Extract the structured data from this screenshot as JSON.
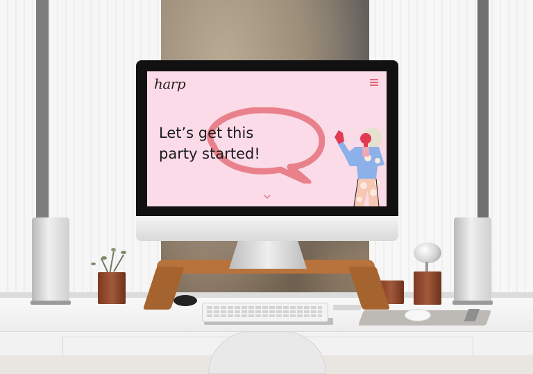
{
  "site": {
    "logo_text": "harp",
    "headline": "Let’s get this\nparty started!",
    "menu_icon": "hamburger-menu-icon",
    "scroll_icon": "chevron-down-icon"
  },
  "colors": {
    "screen_background": "#fbdbe8",
    "accent": "#e2667c",
    "speech_bubble": "#e8818b",
    "headline_text": "#1a1a1a"
  }
}
